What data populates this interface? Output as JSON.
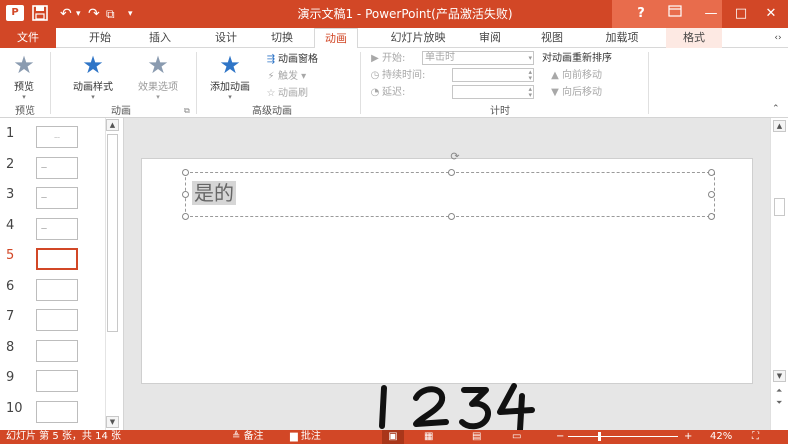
{
  "title_bar": {
    "logo_text": "P",
    "save_icon": "save-icon",
    "undo_icon": "undo-icon",
    "redo_icon": "redo-icon",
    "window_title": "演示文稿1 - PowerPoint(产品激活失败)",
    "help": "?",
    "minimize": "—",
    "restore": "□",
    "close": "✕"
  },
  "tabs": [
    {
      "label": "文件"
    },
    {
      "label": "开始"
    },
    {
      "label": "插入"
    },
    {
      "label": "设计"
    },
    {
      "label": "切换"
    },
    {
      "label": "动画",
      "active": true
    },
    {
      "label": "幻灯片放映"
    },
    {
      "label": "审阅"
    },
    {
      "label": "视图"
    },
    {
      "label": "加载项"
    },
    {
      "label": "格式"
    }
  ],
  "ribbon": {
    "preview_group": {
      "preview_label": "预览",
      "group_label": "预览"
    },
    "animation_group": {
      "animation_styles_label": "动画样式",
      "effect_options_label": "效果选项",
      "group_label": "动画"
    },
    "advanced_group": {
      "add_animation_label": "添加动画",
      "animation_pane_label": "动画窗格",
      "trigger_label": "触发",
      "animation_painter_label": "动画刷",
      "group_label": "高级动画"
    },
    "timing_group": {
      "start_label": "开始:",
      "start_value": "单击时",
      "duration_label": "持续时间:",
      "delay_label": "延迟:",
      "group_label": "计时"
    },
    "reorder_group": {
      "title": "对动画重新排序",
      "move_earlier": "向前移动",
      "move_later": "向后移动"
    }
  },
  "thumbnails": [
    {
      "number": "1",
      "preview_text": "..."
    },
    {
      "number": "2",
      "preview_text": "—"
    },
    {
      "number": "3",
      "preview_text": "—"
    },
    {
      "number": "4",
      "preview_text": "—"
    },
    {
      "number": "5",
      "preview_text": "",
      "active": true
    },
    {
      "number": "6",
      "preview_text": ""
    },
    {
      "number": "7",
      "preview_text": ""
    },
    {
      "number": "8",
      "preview_text": ""
    },
    {
      "number": "9",
      "preview_text": ""
    },
    {
      "number": "10",
      "preview_text": ""
    }
  ],
  "slide": {
    "text": "是的"
  },
  "handwriting": "1234",
  "status_bar": {
    "slide_info": "幻灯片 第 5 张，共 14 张",
    "notes": "备注",
    "comments": "批注",
    "zoom_minus": "−",
    "zoom_plus": "+",
    "zoom_level": "42%"
  },
  "colors": {
    "accent": "#D24726",
    "format_tab_bg": "#FDE9E3",
    "star_blue": "#2F75C7"
  }
}
